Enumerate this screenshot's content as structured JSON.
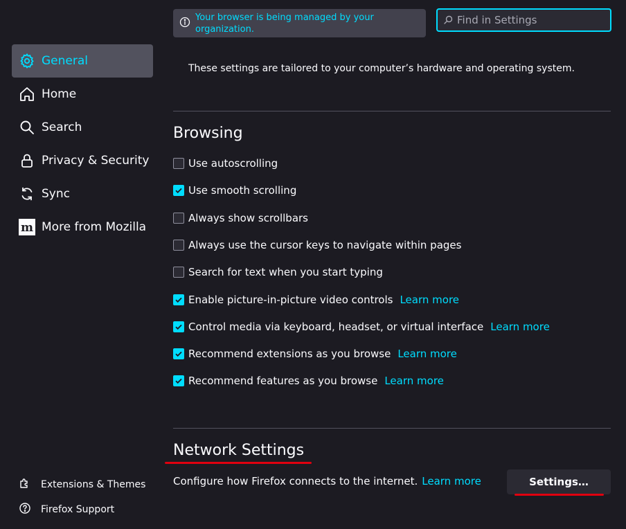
{
  "sidebar": {
    "items": [
      {
        "label": "General",
        "icon": "gear-icon",
        "selected": true
      },
      {
        "label": "Home",
        "icon": "home-icon"
      },
      {
        "label": "Search",
        "icon": "search-icon"
      },
      {
        "label": "Privacy & Security",
        "icon": "lock-icon"
      },
      {
        "label": "Sync",
        "icon": "sync-icon"
      },
      {
        "label": "More from Mozilla",
        "icon": "mozilla-icon"
      }
    ],
    "bottom": [
      {
        "label": "Extensions & Themes",
        "icon": "puzzle-icon"
      },
      {
        "label": "Firefox Support",
        "icon": "help-icon"
      }
    ]
  },
  "managed_notice": "Your browser is being managed by your organization.",
  "search": {
    "placeholder": "Find in Settings"
  },
  "tailored_text": "These settings are tailored to your computer’s hardware and operating system.",
  "browsing": {
    "title": "Browsing",
    "options": [
      {
        "label": "Use autoscrolling",
        "checked": false
      },
      {
        "label": "Use smooth scrolling",
        "checked": true
      },
      {
        "label": "Always show scrollbars",
        "checked": false
      },
      {
        "label": "Always use the cursor keys to navigate within pages",
        "checked": false
      },
      {
        "label": "Search for text when you start typing",
        "checked": false
      },
      {
        "label": "Enable picture-in-picture video controls",
        "checked": true,
        "learn_more": "Learn more"
      },
      {
        "label": "Control media via keyboard, headset, or virtual interface",
        "checked": true,
        "learn_more": "Learn more"
      },
      {
        "label": "Recommend extensions as you browse",
        "checked": true,
        "learn_more": "Learn more"
      },
      {
        "label": "Recommend features as you browse",
        "checked": true,
        "learn_more": "Learn more"
      }
    ]
  },
  "network": {
    "title": "Network Settings",
    "description": "Configure how Firefox connects to the internet.",
    "learn_more": "Learn more",
    "button_label": "Settings…"
  },
  "colors": {
    "accent": "#00ddff",
    "annotation": "#e0000f"
  }
}
